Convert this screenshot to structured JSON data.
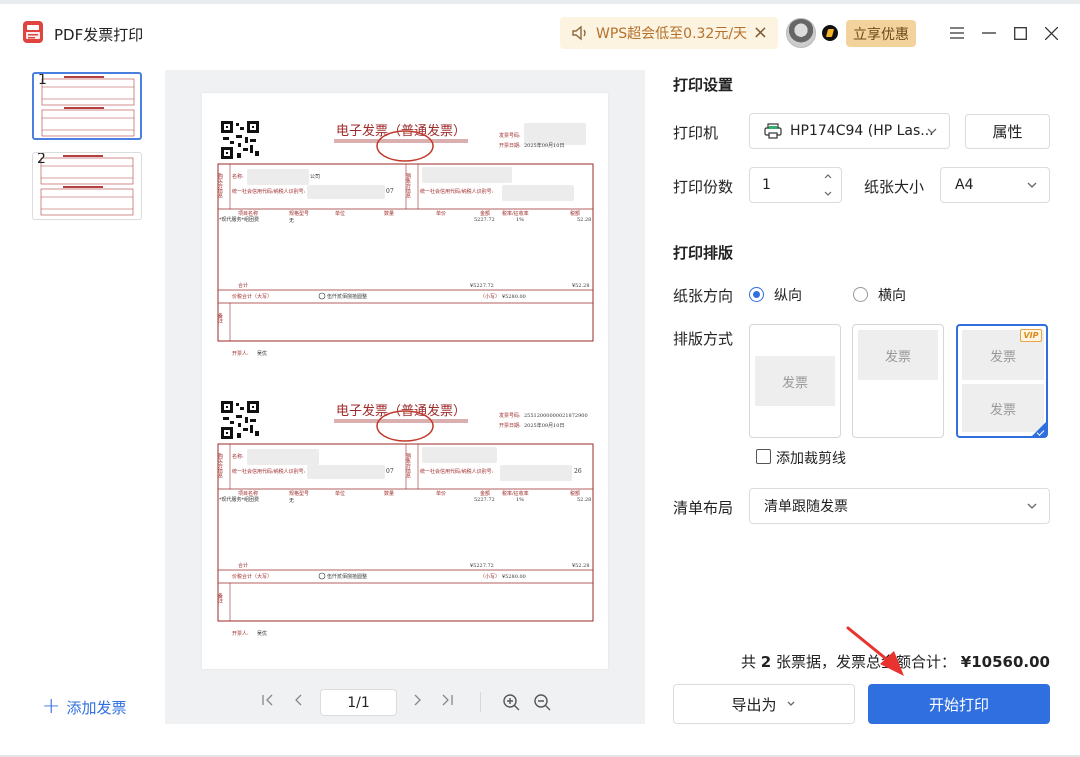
{
  "window": {
    "app_title": "PDF发票打印",
    "promo_text": "WPS超会低至0.32元/天",
    "vip_button": "立享优惠"
  },
  "thumbnails": [
    {
      "num": "1"
    },
    {
      "num": "2"
    }
  ],
  "sidebar": {
    "add_invoice": "添加发票"
  },
  "pager": {
    "current": "1/1"
  },
  "invoice": {
    "title": "电子发票（普通发票）",
    "number_label": "发票号码:",
    "number_value_2": "25512000000021872900",
    "date_label": "开票日期:",
    "date_value": "2025年09月10日",
    "buyer_side": "购买方信息",
    "seller_side": "销售方信息",
    "name_label": "名称:",
    "name_suffix_1": "公司",
    "tax_id_label": "统一社会信用代码/纳税人识别号:",
    "tax_id_tail_1": "07",
    "tax_id_tail_2": "07",
    "seller_tax_tail_2": "26",
    "col_item": "项目名称",
    "col_spec": "规格型号",
    "col_unit": "单位",
    "col_qty": "数量",
    "col_price": "单价",
    "col_amount": "金额",
    "col_rate": "税率/征收率",
    "col_tax": "税额",
    "item_name": "*现代服务*组团费",
    "item_spec": "无",
    "item_amount": "5227.72",
    "item_rate": "1%",
    "item_tax": "52.28",
    "total_label": "合计",
    "total_amount": "¥5227.72",
    "total_tax": "¥52.28",
    "grand_label": "价税合计（大写）",
    "grand_words": "伍仟贰佰捌拾圆整",
    "small_label": "（小写）",
    "grand_value": "¥5280.00",
    "note_label": "备注",
    "issuer_label": "开票人:",
    "issuer_name": "吴优"
  },
  "settings": {
    "print_settings_title": "打印设置",
    "printer_label": "打印机",
    "printer_value": "HP174C94 (HP Las...",
    "properties_button": "属性",
    "copies_label": "打印份数",
    "copies_value": "1",
    "paper_size_label": "纸张大小",
    "paper_size_value": "A4",
    "layout_title": "打印排版",
    "orientation_label": "纸张方向",
    "portrait_label": "纵向",
    "landscape_label": "横向",
    "orientation_selected": "纵向",
    "arrangement_label": "排版方式",
    "placeholder_text": "发票",
    "vip_tag": "VIP",
    "crop_marks_label": "添加裁剪线",
    "list_layout_label": "清单布局",
    "list_layout_value": "清单跟随发票"
  },
  "summary": {
    "prefix": "共",
    "count": "2",
    "middle": "张票据，发票总金额合计：",
    "total": "¥10560.00"
  },
  "actions": {
    "export_label": "导出为",
    "print_label": "开始打印"
  },
  "colors": {
    "accent": "#2f6fe0",
    "invoice_red": "#9e2a2a",
    "promo_bg": "#fdf3e1",
    "vip_bg": "#f3d39b"
  }
}
